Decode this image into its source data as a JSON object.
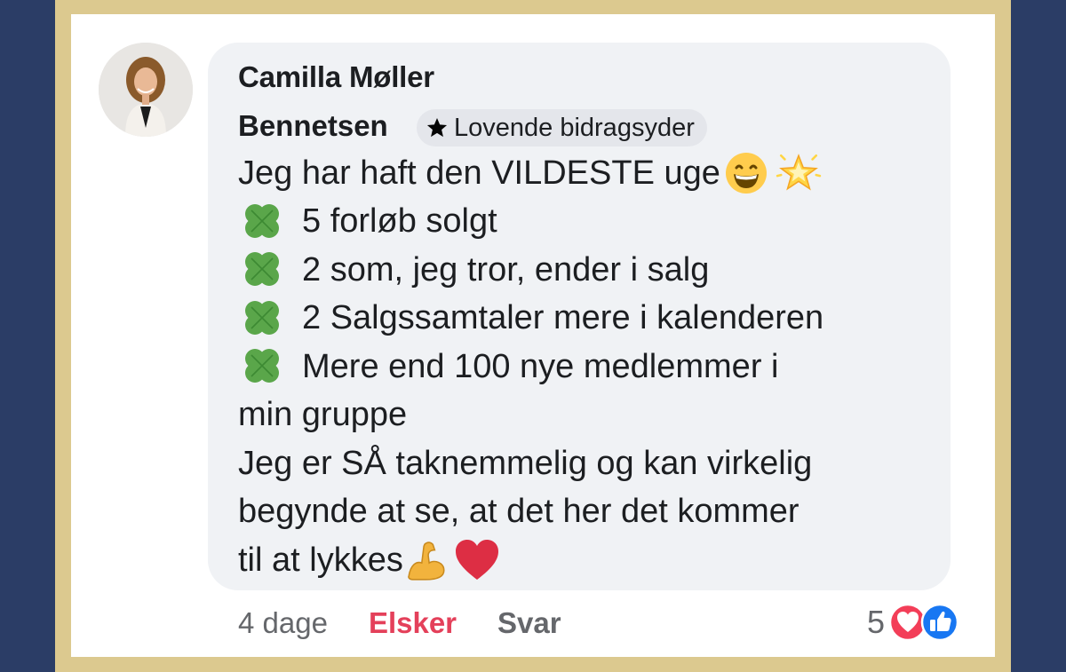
{
  "comment": {
    "author_line1": "Camilla Møller",
    "author_line2": "Bennetsen",
    "badge": {
      "icon": "star-icon",
      "label": "Lovende bidragsyder"
    },
    "lines": [
      "Jeg har haft den VILDESTE uge",
      "5 forløb solgt",
      "2 som, jeg tror, ender i salg",
      "2 Salgssamtaler mere i kalenderen",
      "Mere end 100 nye medlemmer i",
      "min gruppe",
      "Jeg er SÅ taknemmelig og kan virkelig",
      "begynde at se, at det her det kommer",
      "til at lykkes"
    ],
    "emojis": {
      "line1": [
        "grinning-face-icon",
        "glowing-star-icon"
      ],
      "bullet": "four-leaf-clover-icon",
      "last_line": [
        "flexed-biceps-icon",
        "red-heart-icon"
      ]
    }
  },
  "footer": {
    "time": "4 dage",
    "love_label": "Elsker",
    "reply_label": "Svar",
    "reaction_count": "5",
    "reaction_icons": [
      "love-reaction-icon",
      "like-reaction-icon"
    ]
  },
  "colors": {
    "outer_background": "#2b3d66",
    "frame": "#dcc98f",
    "bubble": "#f0f2f5",
    "love": "#e4405a",
    "like": "#1877f2"
  }
}
